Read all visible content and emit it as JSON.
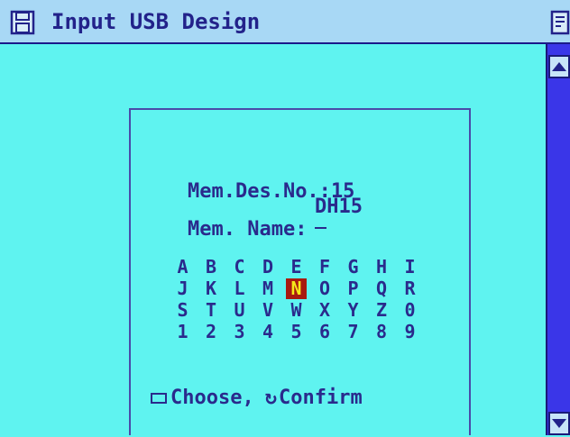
{
  "window": {
    "title": "Input USB Design"
  },
  "dialog": {
    "mem_des_label": "Mem.Des.No.:",
    "mem_des_value": "15",
    "mem_name_label": "Mem. Name:",
    "mem_name_value": "DH15",
    "keyboard": [
      [
        "A",
        "B",
        "C",
        "D",
        "E",
        "F",
        "G",
        "H",
        "I"
      ],
      [
        "J",
        "K",
        "L",
        "M",
        "N",
        "O",
        "P",
        "Q",
        "R"
      ],
      [
        "S",
        "T",
        "U",
        "V",
        "W",
        "X",
        "Y",
        "Z",
        "0"
      ],
      [
        "1",
        "2",
        "3",
        "4",
        "5",
        "6",
        "7",
        "8",
        "9"
      ]
    ],
    "selected_key": "N",
    "hint_choose": "Choose,",
    "hint_confirm": "Confirm"
  },
  "colors": {
    "background": "#5ff3f0",
    "titlebar": "#a8d8f5",
    "scrollbar": "#3a36e8",
    "text": "#2a2a8c",
    "selected_bg": "#a81a10",
    "selected_fg": "#f5e81a"
  },
  "icons": {
    "title": "disk-icon",
    "corner": "document-icon",
    "scroll_up": "arrow-up-icon",
    "scroll_down": "arrow-down-icon",
    "choose": "rectangle-key-icon",
    "confirm": "return-arrow-icon"
  }
}
